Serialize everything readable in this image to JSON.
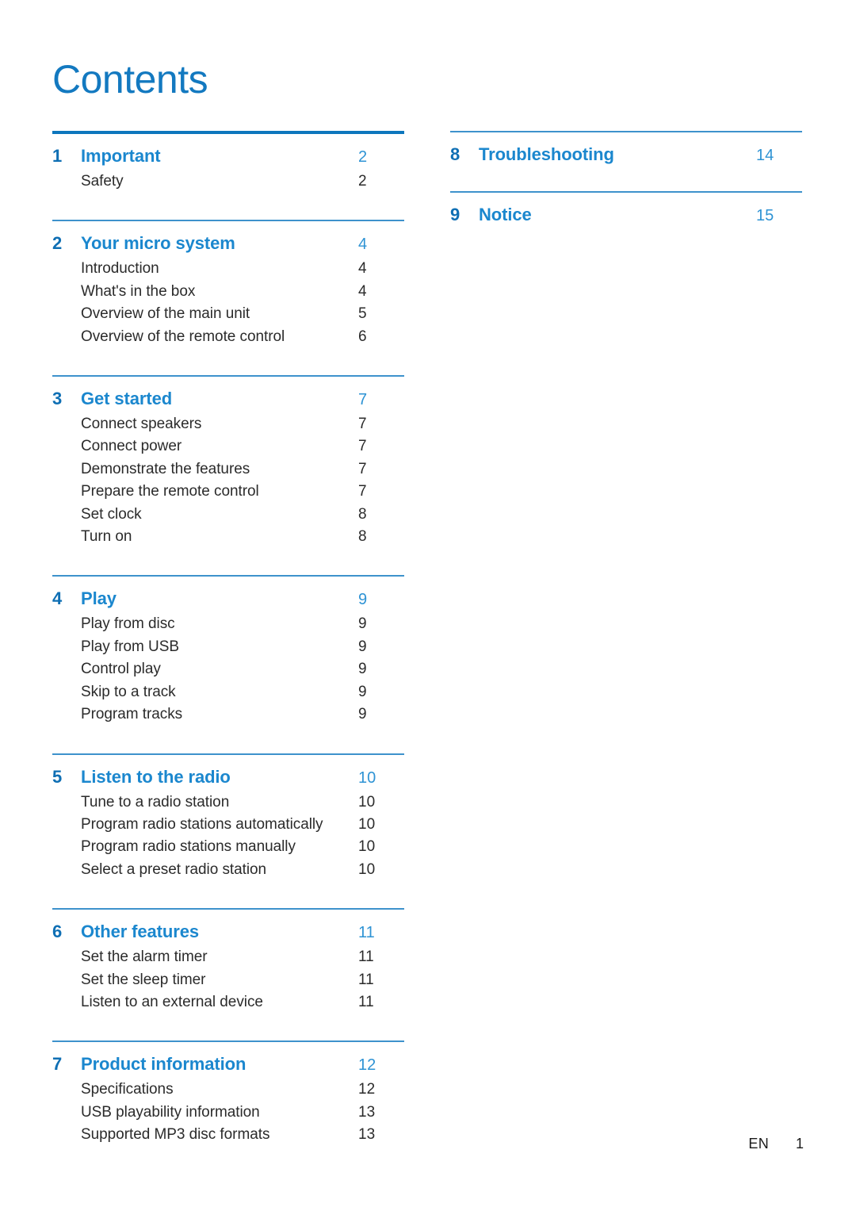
{
  "document": {
    "title": "Contents",
    "accent_color": "#1379C0",
    "heading_color": "#1B87CE",
    "number_color": "#0F6FB4",
    "rule_color": "#3E92CC",
    "rule_color_first": "#0D76BD",
    "body_text_color": "#2B2B2B"
  },
  "footer": {
    "language": "EN",
    "page": "1"
  },
  "columns": {
    "left": [
      {
        "number": "1",
        "title": "Important",
        "page": "2",
        "items": [
          {
            "label": "Safety",
            "page": "2"
          }
        ]
      },
      {
        "number": "2",
        "title": "Your micro system",
        "page": "4",
        "items": [
          {
            "label": "Introduction",
            "page": "4"
          },
          {
            "label": "What's in the box",
            "page": "4"
          },
          {
            "label": "Overview of the main unit",
            "page": "5"
          },
          {
            "label": "Overview of the remote control",
            "page": "6"
          }
        ]
      },
      {
        "number": "3",
        "title": "Get started",
        "page": "7",
        "items": [
          {
            "label": "Connect speakers",
            "page": "7"
          },
          {
            "label": "Connect power",
            "page": "7"
          },
          {
            "label": "Demonstrate the features",
            "page": "7"
          },
          {
            "label": "Prepare the remote control",
            "page": "7"
          },
          {
            "label": "Set clock",
            "page": "8"
          },
          {
            "label": "Turn on",
            "page": "8"
          }
        ]
      },
      {
        "number": "4",
        "title": "Play",
        "page": "9",
        "items": [
          {
            "label": "Play from disc",
            "page": "9"
          },
          {
            "label": "Play from USB",
            "page": "9"
          },
          {
            "label": "Control play",
            "page": "9"
          },
          {
            "label": "Skip to a track",
            "page": "9"
          },
          {
            "label": "Program tracks",
            "page": "9"
          }
        ]
      },
      {
        "number": "5",
        "title": "Listen to the radio",
        "page": "10",
        "items": [
          {
            "label": "Tune to a radio station",
            "page": "10"
          },
          {
            "label": "Program radio stations automatically",
            "page": "10"
          },
          {
            "label": "Program radio stations manually",
            "page": "10"
          },
          {
            "label": "Select a preset radio station",
            "page": "10"
          }
        ]
      },
      {
        "number": "6",
        "title": "Other features",
        "page": "11",
        "items": [
          {
            "label": "Set the alarm timer",
            "page": "11"
          },
          {
            "label": "Set the sleep timer",
            "page": "11"
          },
          {
            "label": "Listen to an external device",
            "page": "11"
          }
        ]
      },
      {
        "number": "7",
        "title": "Product information",
        "page": "12",
        "items": [
          {
            "label": "Specifications",
            "page": "12"
          },
          {
            "label": "USB playability information",
            "page": "13"
          },
          {
            "label": "Supported MP3 disc formats",
            "page": "13"
          }
        ]
      }
    ],
    "right": [
      {
        "number": "8",
        "title": "Troubleshooting",
        "page": "14",
        "items": []
      },
      {
        "number": "9",
        "title": "Notice",
        "page": "15",
        "items": []
      }
    ]
  }
}
